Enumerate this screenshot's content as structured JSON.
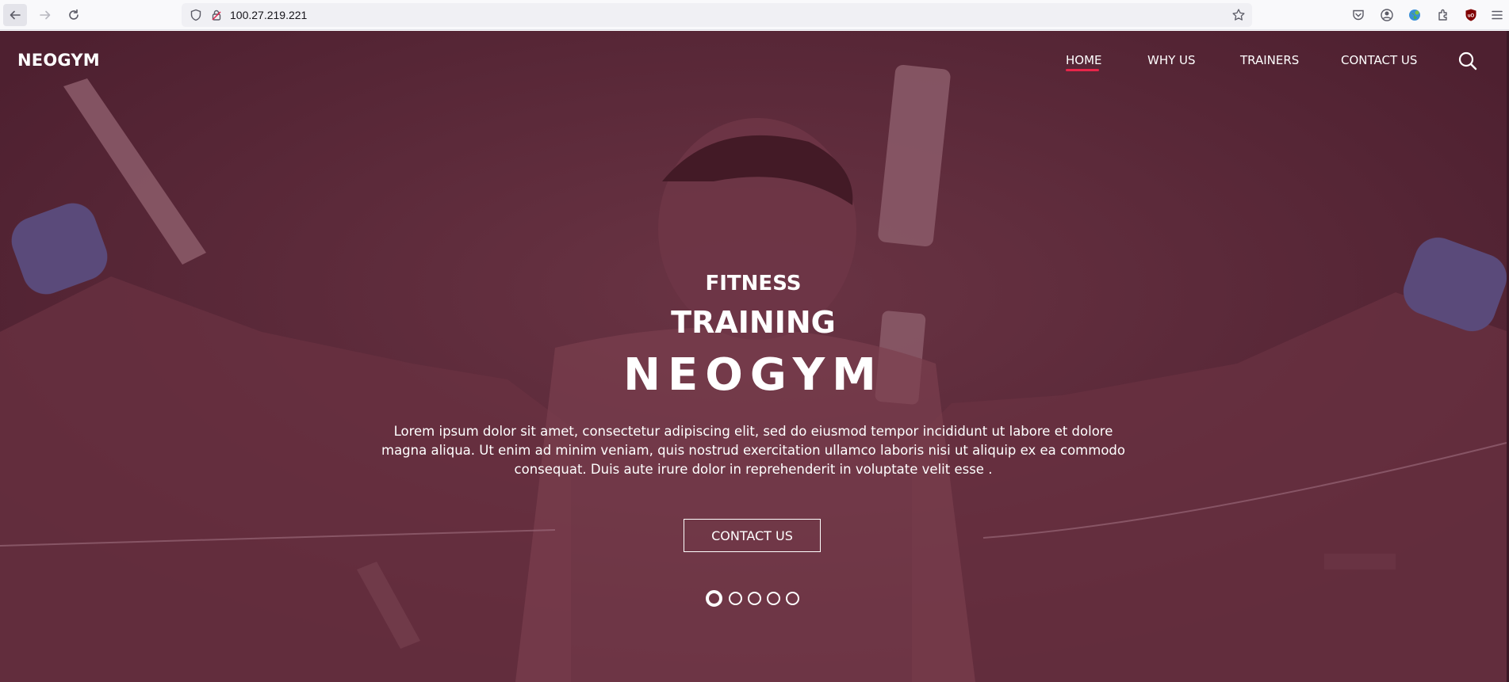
{
  "browser": {
    "url": "100.27.219.221"
  },
  "site": {
    "logo": "NEOGYM",
    "nav": [
      {
        "label": "HOME",
        "active": true
      },
      {
        "label": "WHY US",
        "active": false
      },
      {
        "label": "TRAINERS",
        "active": false
      },
      {
        "label": "CONTACT US",
        "active": false
      }
    ]
  },
  "hero": {
    "kicker": "FITNESS",
    "subtitle": "TRAINING",
    "title": "NEOGYM",
    "text": "Lorem ipsum dolor sit amet, consectetur adipiscing elit, sed do eiusmod tempor incididunt ut labore et dolore magna aliqua. Ut enim ad minim veniam, quis nostrud exercitation ullamco laboris nisi ut aliquip ex ea commodo consequat. Duis aute irure dolor in reprehenderit in voluptate velit esse .",
    "cta_label": "CONTACT US",
    "slides_total": 5,
    "active_slide": 1
  },
  "colors": {
    "overlay": "#532434",
    "accent": "#e8254a",
    "text": "#ffffff"
  },
  "icons": [
    "back-icon",
    "forward-icon",
    "reload-icon",
    "shield-icon",
    "lock-icon",
    "star-icon",
    "pocket-icon",
    "account-icon",
    "globe-extension-icon",
    "extensions-icon",
    "ublock-icon",
    "menu-icon",
    "search-icon"
  ]
}
